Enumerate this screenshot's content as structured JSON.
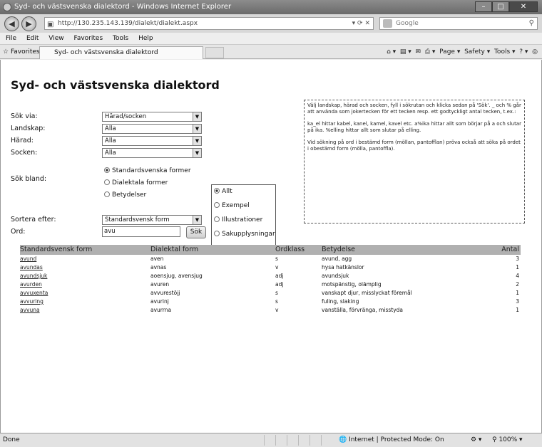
{
  "window": {
    "title": "Syd- och västsvenska dialektord - Windows Internet Explorer"
  },
  "browser": {
    "url": "http://130.235.143.139/dialekt/dialekt.aspx",
    "search_placeholder": "Google",
    "menu": [
      "File",
      "Edit",
      "View",
      "Favorites",
      "Tools",
      "Help"
    ],
    "favorites_label": "Favorites",
    "tab_title": "Syd- och västsvenska dialektord",
    "command_bar": [
      "Page",
      "Safety",
      "Tools"
    ]
  },
  "page": {
    "heading": "Syd- och västsvenska dialektord",
    "labels": {
      "sok_via": "Sök via:",
      "landskap": "Landskap:",
      "harad": "Härad:",
      "socken": "Socken:",
      "sok_bland": "Sök bland:",
      "sortera": "Sortera efter:",
      "ord": "Ord:"
    },
    "selects": {
      "sok_via": "Härad/socken",
      "landskap": "Alla",
      "harad": "Alla",
      "socken": "Alla",
      "sortera": "Standardsvensk form"
    },
    "sok_bland_options": [
      "Standardsvenska former",
      "Dialektala former",
      "Betydelser"
    ],
    "filter_options": [
      "Allt",
      "Exempel",
      "Illustrationer",
      "Sakupplysningar"
    ],
    "ord_value": "avu",
    "search_button": "Sök",
    "help": [
      "Välj landskap, härad och socken, fyll i sökrutan och klicka sedan på 'Sök'. _ och % går att använda som jokertecken för ett tecken resp. ett godtyckligt antal tecken, t.ex.:",
      "ka_el hittar kabel, kanel, kamel, kavel etc. a%ika hittar allt som börjar på a och slutar på ika. %elling hittar allt som slutar på elling.",
      "Vid sökning på ord i bestämd form (möllan, pantofflan) pröva också att söka på ordet i obestämd form (mölla, pantoffla)."
    ]
  },
  "table": {
    "headers": [
      "Standardsvensk form",
      "Dialektal form",
      "Ordklass",
      "Betydelse",
      "Antal"
    ],
    "rows": [
      [
        "avund",
        "aven",
        "s",
        "avund, agg",
        "3"
      ],
      [
        "avundas",
        "avnas",
        "v",
        "hysa hatkänslor",
        "1"
      ],
      [
        "avundsjuk",
        "aoensjug, avensjug",
        "adj",
        "avundsjuk",
        "4"
      ],
      [
        "avurden",
        "avuren",
        "adj",
        "motspänstig, olämplig",
        "2"
      ],
      [
        "avvuxenta",
        "avvurestöjj",
        "s",
        "vanskapt djur, misslyckat föremål",
        "1"
      ],
      [
        "avvuring",
        "avurinj",
        "s",
        "fuling, slaking",
        "3"
      ],
      [
        "avvuna",
        "avurrna",
        "v",
        "vanställa, förvränga, misstyda",
        "1"
      ]
    ]
  },
  "status": {
    "left": "Done",
    "zone": "Internet | Protected Mode: On",
    "zoom": "100%"
  }
}
